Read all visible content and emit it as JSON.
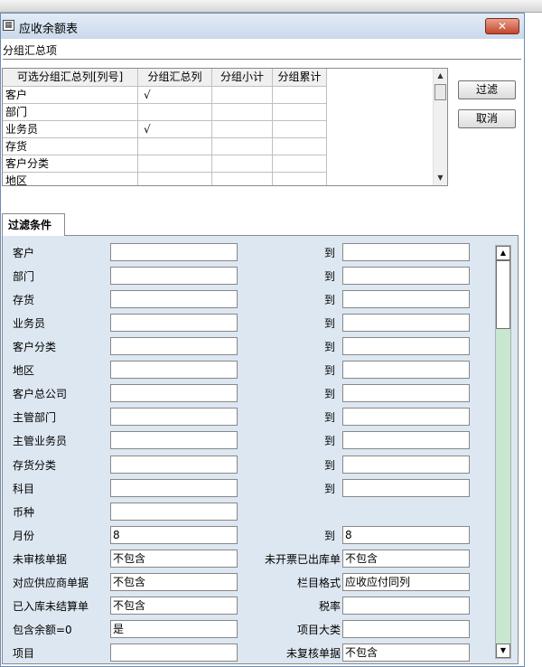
{
  "window": {
    "title": "应收余额表",
    "close_label": "✕"
  },
  "group_section": {
    "label": "分组汇总项",
    "columns": [
      "可选分组汇总列[列号]",
      "分组汇总列",
      "分组小计",
      "分组累计"
    ],
    "rows": [
      {
        "name": "客户",
        "group": "√",
        "subtotal": "",
        "cumulative": ""
      },
      {
        "name": "部门",
        "group": "",
        "subtotal": "",
        "cumulative": ""
      },
      {
        "name": "业务员",
        "group": "√",
        "subtotal": "",
        "cumulative": ""
      },
      {
        "name": "存货",
        "group": "",
        "subtotal": "",
        "cumulative": ""
      },
      {
        "name": "客户分类",
        "group": "",
        "subtotal": "",
        "cumulative": ""
      },
      {
        "name": "地区",
        "group": "",
        "subtotal": "",
        "cumulative": ""
      }
    ]
  },
  "buttons": {
    "filter": "过滤",
    "cancel": "取消"
  },
  "tab": {
    "label": "过滤条件"
  },
  "to_label": "到",
  "filters": [
    {
      "label": "客户",
      "from": "",
      "to": ""
    },
    {
      "label": "部门",
      "from": "",
      "to": ""
    },
    {
      "label": "存货",
      "from": "",
      "to": ""
    },
    {
      "label": "业务员",
      "from": "",
      "to": ""
    },
    {
      "label": "客户分类",
      "from": "",
      "to": ""
    },
    {
      "label": "地区",
      "from": "",
      "to": ""
    },
    {
      "label": "客户总公司",
      "from": "",
      "to": ""
    },
    {
      "label": "主管部门",
      "from": "",
      "to": ""
    },
    {
      "label": "主管业务员",
      "from": "",
      "to": ""
    },
    {
      "label": "存货分类",
      "from": "",
      "to": ""
    },
    {
      "label": "科目",
      "from": "",
      "to": ""
    }
  ],
  "currency": {
    "label": "币种",
    "value": ""
  },
  "month": {
    "label": "月份",
    "from": "8",
    "to": "8"
  },
  "options": [
    {
      "left_label": "未审核单据",
      "left_value": "不包含",
      "right_label": "未开票已出库单",
      "right_value": "不包含"
    },
    {
      "left_label": "对应供应商单据",
      "left_value": "不包含",
      "right_label": "栏目格式",
      "right_value": "应收应付同列"
    },
    {
      "left_label": "已入库未结算单",
      "left_value": "不包含",
      "right_label": "税率",
      "right_value": ""
    },
    {
      "left_label": "包含余额=0",
      "left_value": "是",
      "right_label": "项目大类",
      "right_value": ""
    },
    {
      "left_label": "项目",
      "left_value": "",
      "right_label": "未复核单据",
      "right_value": "不包含"
    }
  ]
}
